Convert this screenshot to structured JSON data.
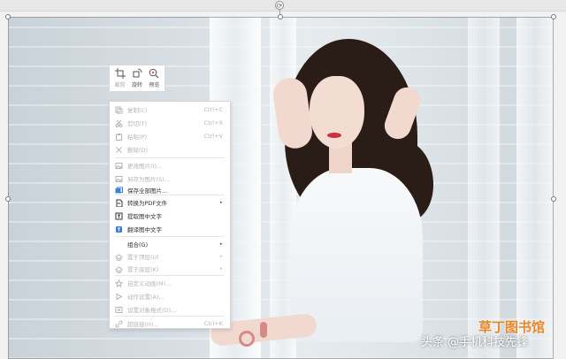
{
  "mini_toolbar": {
    "crop_label": "裁剪",
    "rotate_label": "旋转",
    "preview_label": "预览"
  },
  "context_menu": {
    "items": [
      {
        "label": "复制(C)",
        "shortcut": "Ctrl+C",
        "icon": "copy-icon",
        "enabled": false
      },
      {
        "label": "剪切(T)",
        "shortcut": "Ctrl+X",
        "icon": "scissors-icon",
        "enabled": false
      },
      {
        "label": "粘贴(P)",
        "shortcut": "Ctrl+V",
        "icon": "paste-icon",
        "enabled": false
      },
      {
        "label": "删除(D)",
        "shortcut": "",
        "icon": "delete-icon",
        "enabled": false
      },
      {
        "label": "更改图片(I)...",
        "shortcut": "",
        "icon": "change-picture-icon",
        "enabled": false
      },
      {
        "label": "另存为图片(S)...",
        "shortcut": "",
        "icon": "save-as-picture-icon",
        "enabled": false
      },
      {
        "label": "保存全部图片...",
        "shortcut": "",
        "icon": "save-all-pictures-icon",
        "enabled": true
      },
      {
        "label": "转换为PDF文件",
        "shortcut": "",
        "icon": "pdf-icon",
        "enabled": true,
        "submenu": true
      },
      {
        "label": "提取图中文字",
        "shortcut": "",
        "icon": "extract-text-icon",
        "enabled": true
      },
      {
        "label": "翻译图中文字",
        "shortcut": "",
        "icon": "translate-icon",
        "enabled": true
      },
      {
        "label": "组合(G)",
        "shortcut": "",
        "icon": "",
        "enabled": true,
        "submenu": true
      },
      {
        "label": "置于顶层(U)",
        "shortcut": "",
        "icon": "bring-to-front-icon",
        "enabled": false,
        "submenu": true
      },
      {
        "label": "置于底层(K)",
        "shortcut": "",
        "icon": "send-to-back-icon",
        "enabled": false,
        "submenu": true
      },
      {
        "label": "自定义动画(M)...",
        "shortcut": "",
        "icon": "animation-icon",
        "enabled": false
      },
      {
        "label": "动作设置(A)...",
        "shortcut": "",
        "icon": "action-icon",
        "enabled": false
      },
      {
        "label": "设置对象格式(O)...",
        "shortcut": "",
        "icon": "format-object-icon",
        "enabled": false
      },
      {
        "label": "超链接(H)...",
        "shortcut": "Ctrl+K",
        "icon": "hyperlink-icon",
        "enabled": false
      }
    ],
    "arrow_glyph": "▸"
  },
  "watermark": {
    "site": "草丁图书馆",
    "author": "头条 @手机科技先锋"
  },
  "colors": {
    "menu_disabled": "#b5b5b5",
    "menu_enabled": "#333333",
    "watermark_orange": "#e8872a"
  }
}
